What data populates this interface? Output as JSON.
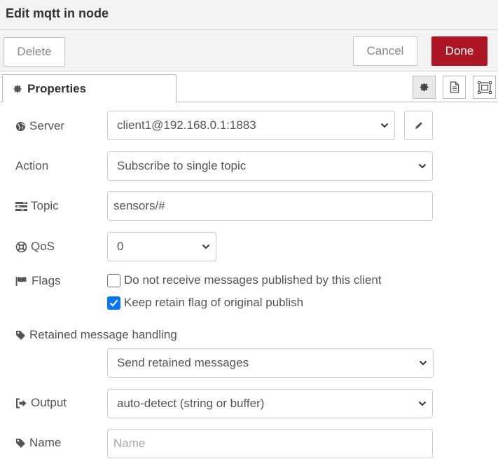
{
  "header": {
    "title": "Edit mqtt in node"
  },
  "toolbar": {
    "delete_label": "Delete",
    "cancel_label": "Cancel",
    "done_label": "Done"
  },
  "tabs": {
    "properties_label": "Properties"
  },
  "form": {
    "server": {
      "label": "Server",
      "value": "client1@192.168.0.1:1883"
    },
    "action": {
      "label": "Action",
      "value": "Subscribe to single topic"
    },
    "topic": {
      "label": "Topic",
      "value": "sensors/#"
    },
    "qos": {
      "label": "QoS",
      "value": "0"
    },
    "flags": {
      "label": "Flags",
      "no_local": {
        "label": "Do not receive messages published by this client",
        "checked": false
      },
      "rap": {
        "label": "Keep retain flag of original publish",
        "checked": true
      }
    },
    "retained": {
      "label": "Retained message handling",
      "value": "Send retained messages"
    },
    "output": {
      "label": "Output",
      "value": "auto-detect (string or buffer)"
    },
    "name": {
      "label": "Name",
      "placeholder": "Name",
      "value": ""
    }
  },
  "colors": {
    "done_bg": "#ad1625",
    "checkbox_checked": "#0075ff"
  }
}
